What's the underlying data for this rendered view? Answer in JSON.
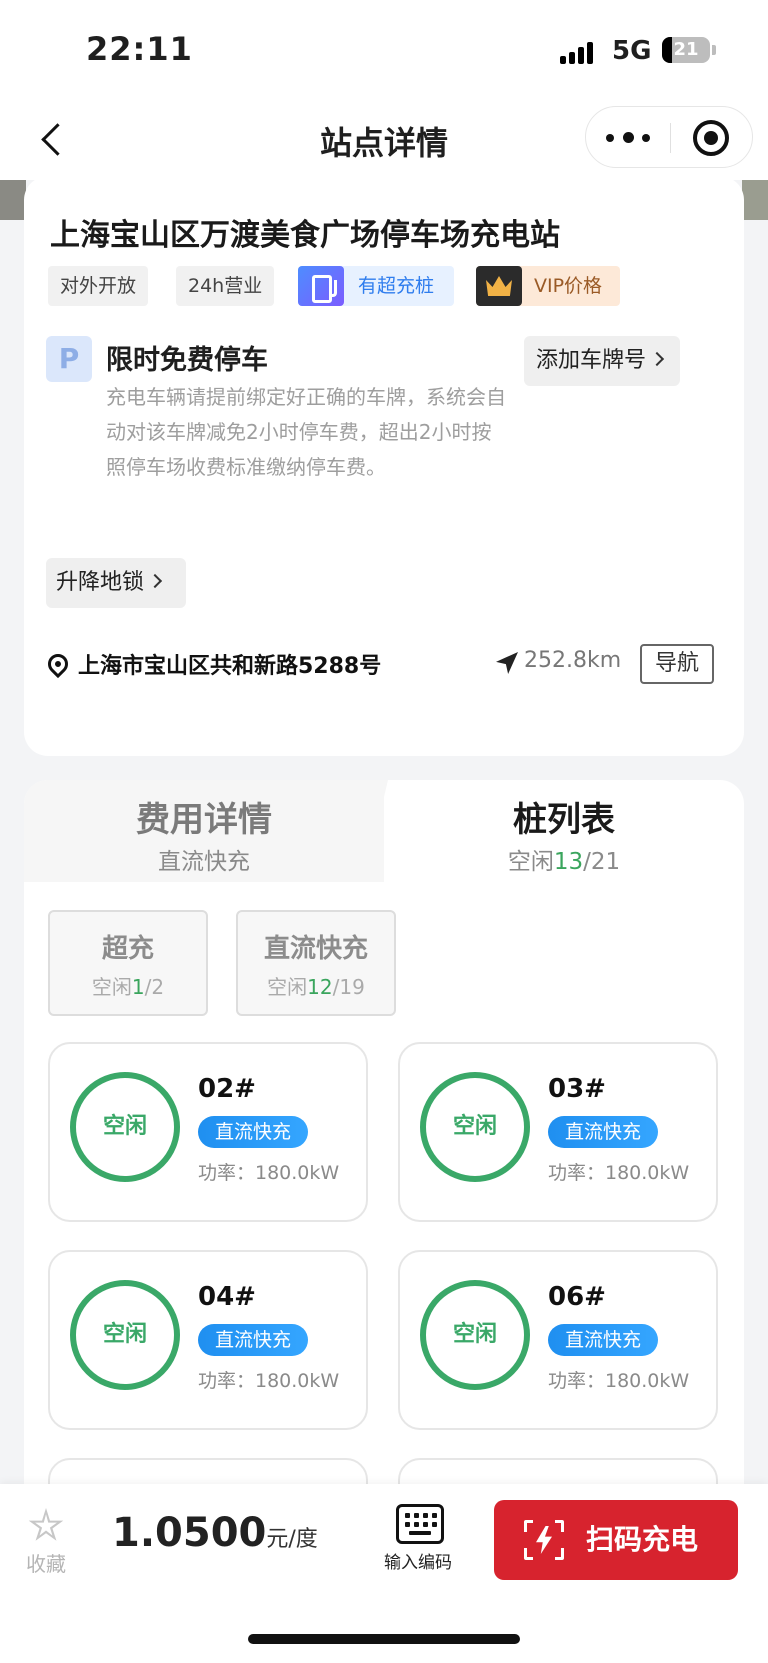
{
  "status_bar": {
    "time": "22:11",
    "network": "5G",
    "battery": "21",
    "battery_level": 0.21
  },
  "nav": {
    "title": "站点详情"
  },
  "station": {
    "name": "上海宝山区万渡美食广场停车场充电站",
    "tags": [
      "对外开放",
      "24h营业",
      "有超充桩",
      "VIP价格"
    ],
    "parking": {
      "title": "限时免费停车",
      "description": "充电车辆请提前绑定好正确的车牌，系统会自动对该车牌减免2小时停车费，超出2小时按照停车场收费标准缴纳停车费。",
      "add_plate_label": "添加车牌号"
    },
    "lock_label": "升降地锁",
    "address": "上海市宝山区共和新路5288号",
    "distance": "252.8km",
    "navigate_label": "导航"
  },
  "tabs": {
    "fee": {
      "title": "费用详情",
      "sub": "直流快充"
    },
    "piles": {
      "title": "桩列表",
      "sub_prefix": "空闲",
      "free": "13",
      "total": "/21"
    }
  },
  "filters": [
    {
      "name": "超充",
      "prefix": "空闲",
      "free": "1",
      "total": "/2"
    },
    {
      "name": "直流快充",
      "prefix": "空闲",
      "free": "12",
      "total": "/19"
    }
  ],
  "piles": [
    {
      "status": "空闲",
      "id": "02#",
      "type": "直流快充",
      "power": "功率：180.0kW"
    },
    {
      "status": "空闲",
      "id": "03#",
      "type": "直流快充",
      "power": "功率：180.0kW"
    },
    {
      "status": "空闲",
      "id": "04#",
      "type": "直流快充",
      "power": "功率：180.0kW"
    },
    {
      "status": "空闲",
      "id": "06#",
      "type": "直流快充",
      "power": "功率：180.0kW"
    }
  ],
  "bottom": {
    "favorite_label": "收藏",
    "price": "1.0500",
    "price_unit": "元/度",
    "input_code_label": "输入编码",
    "scan_label": "扫码充电"
  },
  "colors": {
    "accent_red": "#d7232e",
    "free_green": "#3aa868",
    "badge_blue": "#1f8ff0"
  },
  "icons": [
    "back-icon",
    "more-icon",
    "target-icon",
    "super-charge-icon",
    "vip-crown-icon",
    "parking-icon",
    "location-icon",
    "navigate-arrow-icon",
    "star-icon",
    "keypad-icon",
    "scan-charge-icon"
  ]
}
